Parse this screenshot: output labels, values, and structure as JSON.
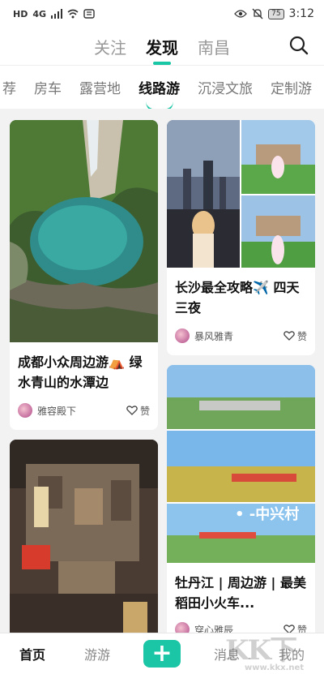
{
  "status_bar": {
    "network": "HD",
    "signal": "4G",
    "battery": "75",
    "time": "3:12"
  },
  "header": {
    "tabs": [
      {
        "label": "关注",
        "active": false
      },
      {
        "label": "发现",
        "active": true
      },
      {
        "label": "南昌",
        "active": false
      }
    ],
    "search_icon": "search-icon"
  },
  "categories": [
    {
      "label": "荐",
      "active": false
    },
    {
      "label": "房车",
      "active": false
    },
    {
      "label": "露营地",
      "active": false
    },
    {
      "label": "线路游",
      "active": true
    },
    {
      "label": "沉浸文旅",
      "active": false
    },
    {
      "label": "定制游",
      "active": false
    }
  ],
  "cards": [
    {
      "title": "成都小众周边游⛺ 绿水青山的水潭边",
      "author": "雅容殿下",
      "like_label": "赞"
    },
    {
      "title": "长沙最全攻略✈️ 四天三夜",
      "author": "暴风雅青",
      "like_label": "赞"
    },
    {
      "title": "",
      "author": "",
      "like_label": ""
    },
    {
      "title": "牡丹江 | 周边游 | 最美稻田小火车...",
      "author": "穿心雅辰",
      "like_label": "赞",
      "image_caption": "• -中兴村"
    }
  ],
  "bottom_nav": {
    "items": [
      {
        "label": "首页",
        "active": true
      },
      {
        "label": "游游",
        "active": false
      },
      {
        "label": "+",
        "active": false
      },
      {
        "label": "消息",
        "active": false
      },
      {
        "label": "我的",
        "active": false
      }
    ]
  },
  "watermark": {
    "text": "KK下载",
    "url": "www.kkx.net"
  },
  "colors": {
    "accent": "#19c6a6"
  }
}
